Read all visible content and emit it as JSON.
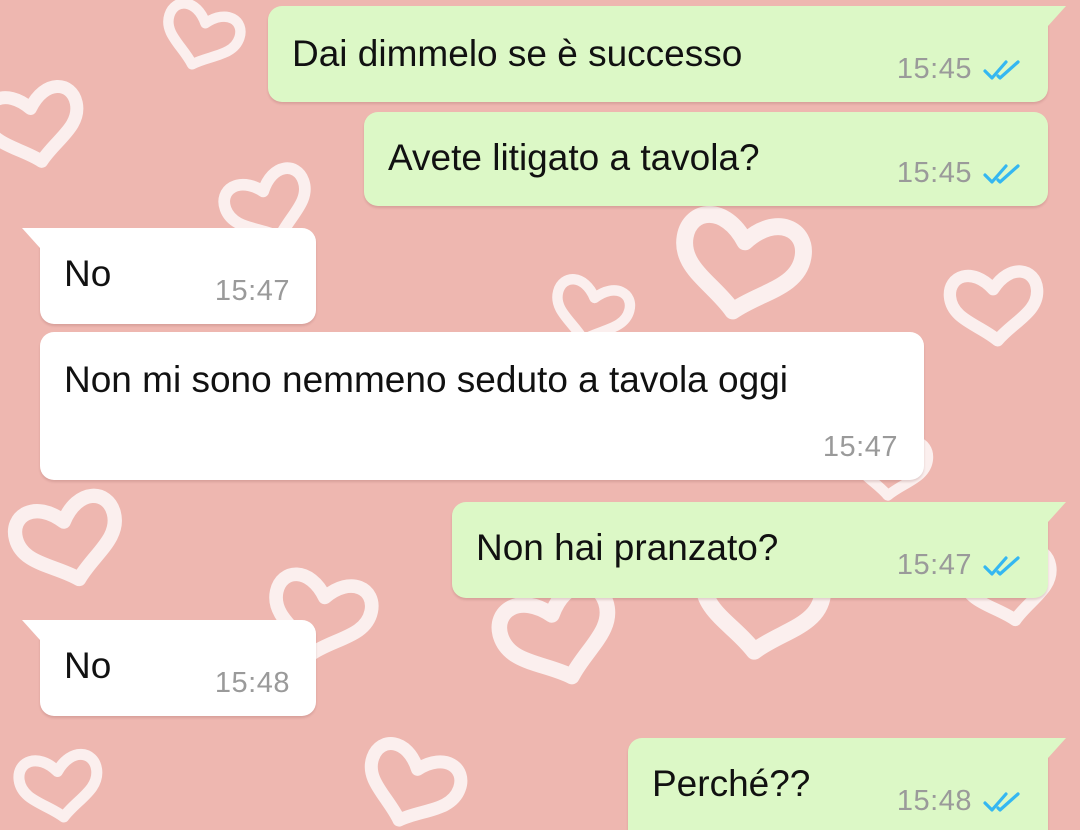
{
  "chat": {
    "messages": [
      {
        "direction": "out",
        "text": "Dai dimmelo se è successo",
        "time": "15:45",
        "status_icon": "double-check-read-icon"
      },
      {
        "direction": "out",
        "text": "Avete litigato a tavola?",
        "time": "15:45",
        "status_icon": "double-check-read-icon"
      },
      {
        "direction": "in",
        "text": "No",
        "time": "15:47"
      },
      {
        "direction": "in",
        "text": "Non mi sono nemmeno seduto a tavola oggi",
        "time": "15:47"
      },
      {
        "direction": "out",
        "text": "Non hai pranzato?",
        "time": "15:47",
        "status_icon": "double-check-read-icon"
      },
      {
        "direction": "in",
        "text": "No",
        "time": "15:48"
      },
      {
        "direction": "out",
        "text": "Perché??",
        "time": "15:48",
        "status_icon": "double-check-read-icon"
      }
    ]
  },
  "colors": {
    "wallpaper": "#eeb7b0",
    "outgoing_bubble": "#dcf8c6",
    "incoming_bubble": "#ffffff",
    "read_ticks": "#34b7f1",
    "timestamp": "#9a9a9a"
  },
  "wallpaper_pattern": "white-hearts-pattern"
}
